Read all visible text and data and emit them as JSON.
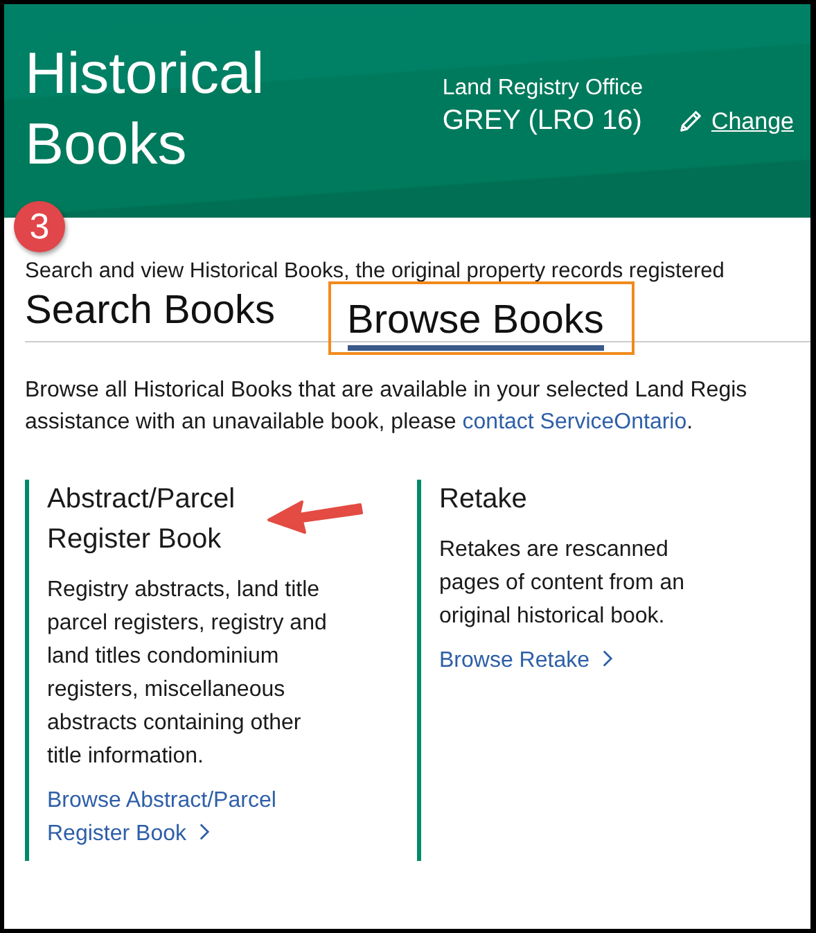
{
  "header": {
    "title": "Historical Books",
    "office_label": "Land Registry Office",
    "office_name": "GREY (LRO 16)",
    "change_link": "Change"
  },
  "step_badge": "3",
  "intro": "Search and view Historical Books, the original property records registered",
  "tabs": [
    {
      "label": "Search Books",
      "selected": false,
      "highlighted": false
    },
    {
      "label": "Browse Books",
      "selected": true,
      "highlighted": true
    }
  ],
  "description": {
    "lines": [
      "Browse all Historical Books that are available in your selected Land Regis",
      "assistance with an unavailable book, please "
    ],
    "link": "contact ServiceOntario",
    "end": "."
  },
  "cards": [
    {
      "title": "Abstract/Parcel Register Book",
      "body": "Registry abstracts, land title parcel registers, registry and land titles condominium registers, miscellaneous abstracts containing other title information.",
      "link": "Browse Abstract/Parcel Register Book",
      "arrow": true
    },
    {
      "title": "Retake",
      "body": "Retakes are rescanned pages of content from an original historical book.",
      "link": "Browse Retake",
      "arrow": false
    }
  ]
}
